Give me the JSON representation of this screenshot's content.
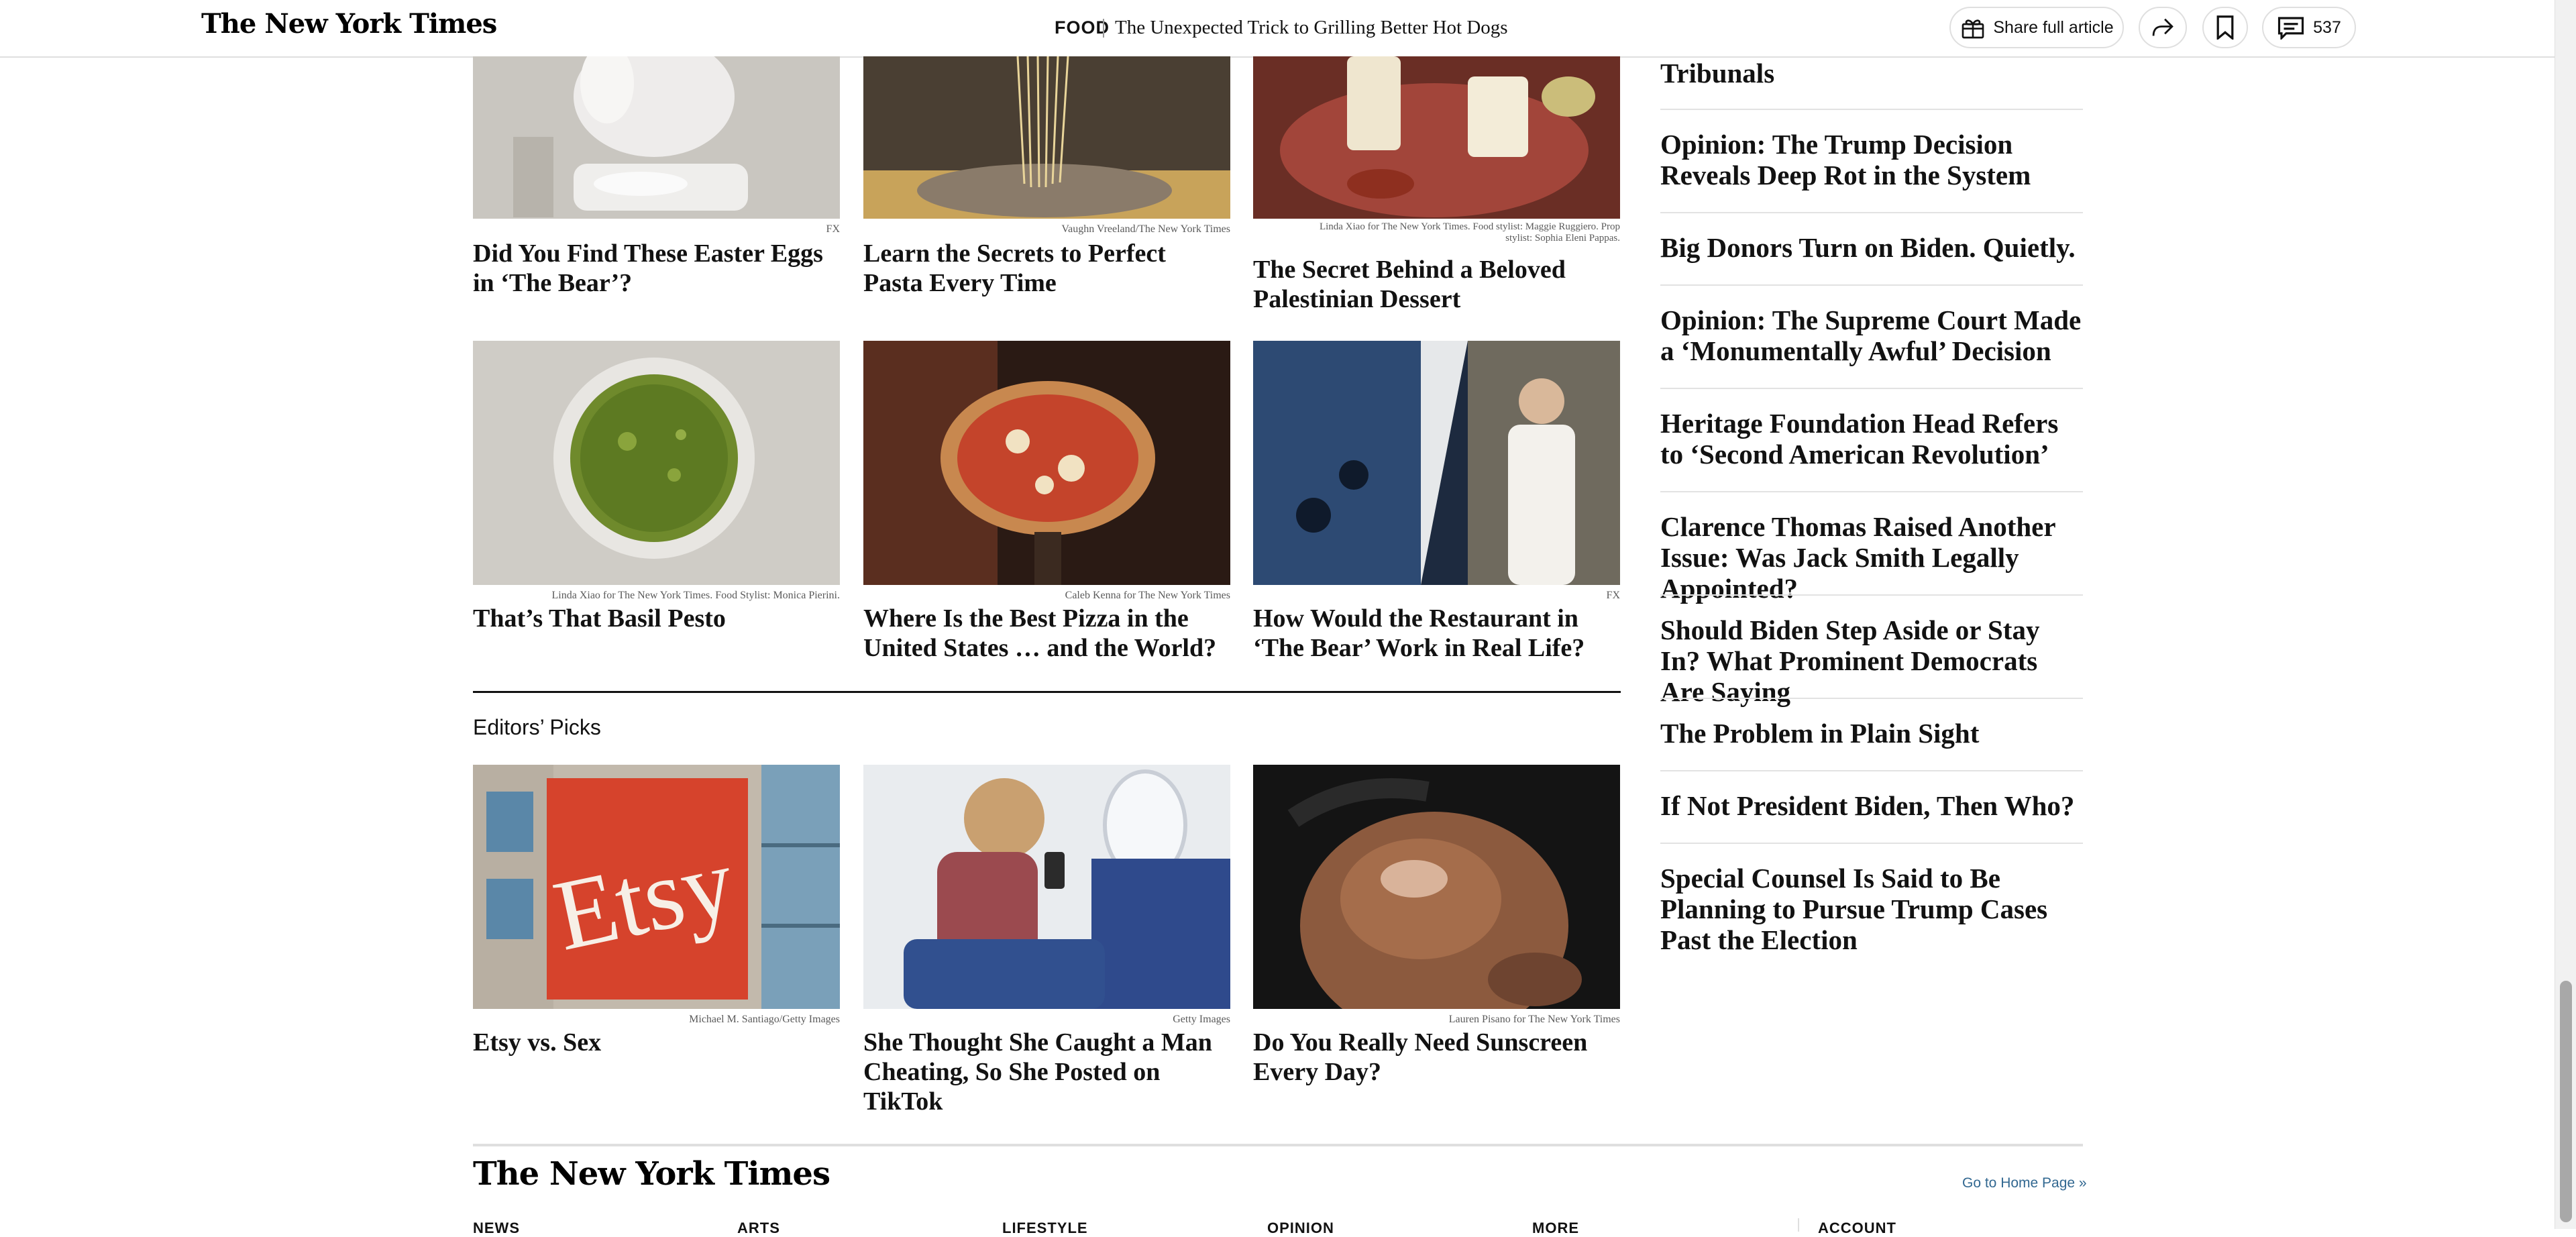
{
  "header": {
    "logo": "The New York Times",
    "section": "FOOD",
    "article_title": "The Unexpected Trick to Grilling Better Hot Dogs",
    "share_label": "Share full article",
    "comment_count": "537"
  },
  "more_stories": [
    {
      "credit": "FX",
      "headline": "Did You Find These Easter Eggs in ‘The Bear’?",
      "image": "chef-plating-photo"
    },
    {
      "credit": "Vaughn Vreeland/The New York Times",
      "headline": "Learn the Secrets to Perfect Pasta Every Time",
      "image": "pasta-photo"
    },
    {
      "credit": "Linda Xiao for The New York Times. Food stylist: Maggie Ruggiero. Prop stylist: Sophia Eleni Pappas.",
      "headline": "The Secret Behind a Beloved Palestinian Dessert",
      "image": "dessert-photo"
    },
    {
      "credit": "Linda Xiao for The New York Times. Food Stylist: Monica Pierini.",
      "headline": "That’s That Basil Pesto",
      "image": "pesto-photo"
    },
    {
      "credit": "Caleb Kenna for The New York Times",
      "headline": "Where Is the Best Pizza in the United States … and the World?",
      "image": "pizza-photo"
    },
    {
      "credit": "FX",
      "headline": "How Would the Restaurant in ‘The Bear’ Work in Real Life?",
      "image": "restaurant-photo"
    }
  ],
  "editors_picks": {
    "label": "Editors’ Picks",
    "items": [
      {
        "credit": "Michael M. Santiago/Getty Images",
        "headline": "Etsy vs. Sex",
        "image": "etsy-sign-photo",
        "sign_text": "Etsy"
      },
      {
        "credit": "Getty Images",
        "headline": "She Thought She Caught a Man Cheating, So She Posted on TikTok",
        "image": "airplane-phone-photo"
      },
      {
        "credit": "Lauren Pisano for The New York Times",
        "headline": "Do You Really Need Sunscreen Every Day?",
        "image": "sunscreen-shoulder-photo"
      }
    ]
  },
  "right_rail": [
    "Tribunals",
    "Opinion: The Trump Decision Reveals Deep Rot in the System",
    "Big Donors Turn on Biden. Quietly.",
    "Opinion: The Supreme Court Made a ‘Monumentally Awful’ Decision",
    "Heritage Foundation Head Refers to ‘Second American Revolution’",
    "Clarence Thomas Raised Another Issue: Was Jack Smith Legally Appointed?",
    "Should Biden Step Aside or Stay In? What Prominent Democrats Are Saying",
    "The Problem in Plain Sight",
    "If Not President Biden, Then Who?",
    "Special Counsel Is Said to Be Planning to Pursue Trump Cases Past the Election"
  ],
  "footer": {
    "logo": "The New York Times",
    "go_home": "Go to Home Page »",
    "nav": [
      "NEWS",
      "ARTS",
      "LIFESTYLE",
      "OPINION",
      "MORE",
      "ACCOUNT"
    ]
  },
  "colors": {
    "link": "#326891",
    "text": "#121212",
    "rule": "#dfdfdf"
  }
}
